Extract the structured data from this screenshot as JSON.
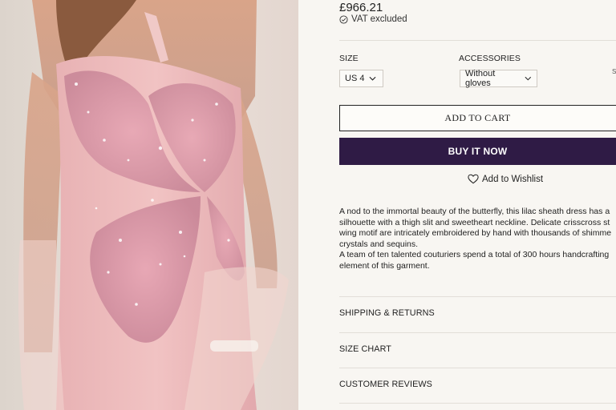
{
  "product": {
    "price": "£966.21",
    "vat_note": "VAT excluded"
  },
  "options": {
    "size_label": "SIZE",
    "size_value": "US 4",
    "accessories_label": "ACCESSORIES",
    "accessories_value": "Without gloves",
    "right_edge_hint": "S"
  },
  "actions": {
    "add_to_cart": "ADD TO CART",
    "buy_now": "BUY IT NOW",
    "wishlist": "Add to Wishlist"
  },
  "description": {
    "lines": [
      "A nod to the immortal beauty of the butterfly, this lilac sheath dress has a",
      "silhouette with a thigh slit and sweetheart neckline. Delicate crisscross st",
      "wing motif are intricately embroidered by hand with thousands of shimme",
      "crystals and sequins.",
      "A team of ten talented couturiers spend a total of 300 hours handcrafting",
      "element of this garment."
    ]
  },
  "accordions": [
    {
      "label": "SHIPPING & RETURNS"
    },
    {
      "label": "SIZE CHART"
    },
    {
      "label": "CUSTOMER REVIEWS"
    }
  ],
  "colors": {
    "primary_button": "#2f1b45",
    "background": "#f8f6f2",
    "divider": "#e2ded8"
  },
  "icons": [
    "check-circle-icon",
    "chevron-down-icon",
    "heart-icon"
  ]
}
